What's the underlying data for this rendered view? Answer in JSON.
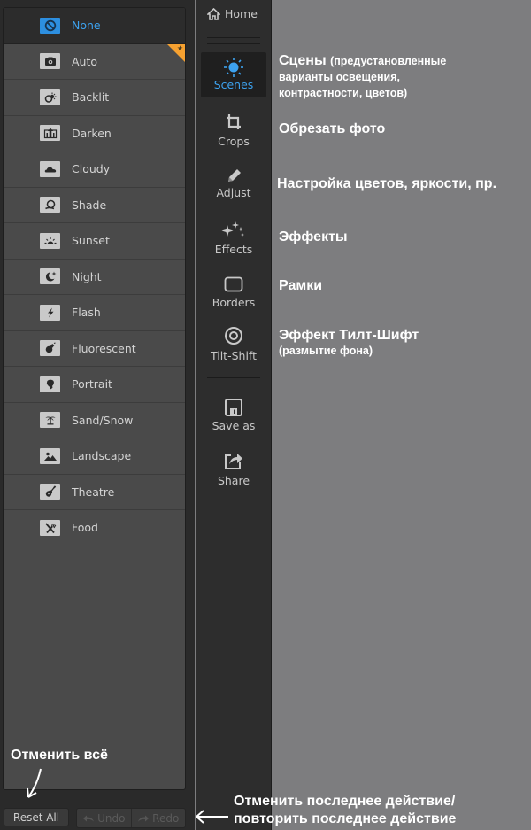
{
  "scenes": {
    "items": [
      {
        "label": "None",
        "icon": "no-entry-icon",
        "selected": true
      },
      {
        "label": "Auto",
        "icon": "camera-icon",
        "badge": "star"
      },
      {
        "label": "Backlit",
        "icon": "backlit-icon"
      },
      {
        "label": "Darken",
        "icon": "darken-icon"
      },
      {
        "label": "Cloudy",
        "icon": "cloud-icon"
      },
      {
        "label": "Shade",
        "icon": "shade-icon"
      },
      {
        "label": "Sunset",
        "icon": "sunset-icon"
      },
      {
        "label": "Night",
        "icon": "moon-star-icon"
      },
      {
        "label": "Flash",
        "icon": "lightning-icon"
      },
      {
        "label": "Fluorescent",
        "icon": "bulb-icon"
      },
      {
        "label": "Portrait",
        "icon": "portrait-icon"
      },
      {
        "label": "Sand/Snow",
        "icon": "palm-tree-icon"
      },
      {
        "label": "Landscape",
        "icon": "landscape-icon"
      },
      {
        "label": "Theatre",
        "icon": "guitar-icon"
      },
      {
        "label": "Food",
        "icon": "fork-knife-icon"
      }
    ]
  },
  "buttons": {
    "reset_all": "Reset All",
    "undo": "Undo",
    "redo": "Redo"
  },
  "nav": {
    "home": "Home",
    "items": [
      {
        "label": "Scenes",
        "active": true
      },
      {
        "label": "Crops"
      },
      {
        "label": "Adjust"
      },
      {
        "label": "Effects"
      },
      {
        "label": "Borders"
      },
      {
        "label": "Tilt-Shift"
      },
      {
        "label": "Save as"
      },
      {
        "label": "Share"
      }
    ]
  },
  "annotations": {
    "scenes_title": "Сцены",
    "scenes_desc_1": "(предустановленные",
    "scenes_desc_2": "варианты освещения,",
    "scenes_desc_3": "контрастности, цветов)",
    "crops": "Обрезать фото",
    "adjust": "Настройка цветов, яркости, пр.",
    "effects": "Эффекты",
    "borders": "Рамки",
    "tiltshift": "Эффект Тилт-Шифт",
    "tiltshift_desc": "(размытие фона)",
    "reset_all": "Отменить всё",
    "undo_redo_1": "Отменить последнее действие/",
    "undo_redo_2": "повторить последнее действие"
  },
  "colors": {
    "accent": "#3da2ef",
    "badge": "#f6a130",
    "canvas": "#7d7d7f"
  }
}
